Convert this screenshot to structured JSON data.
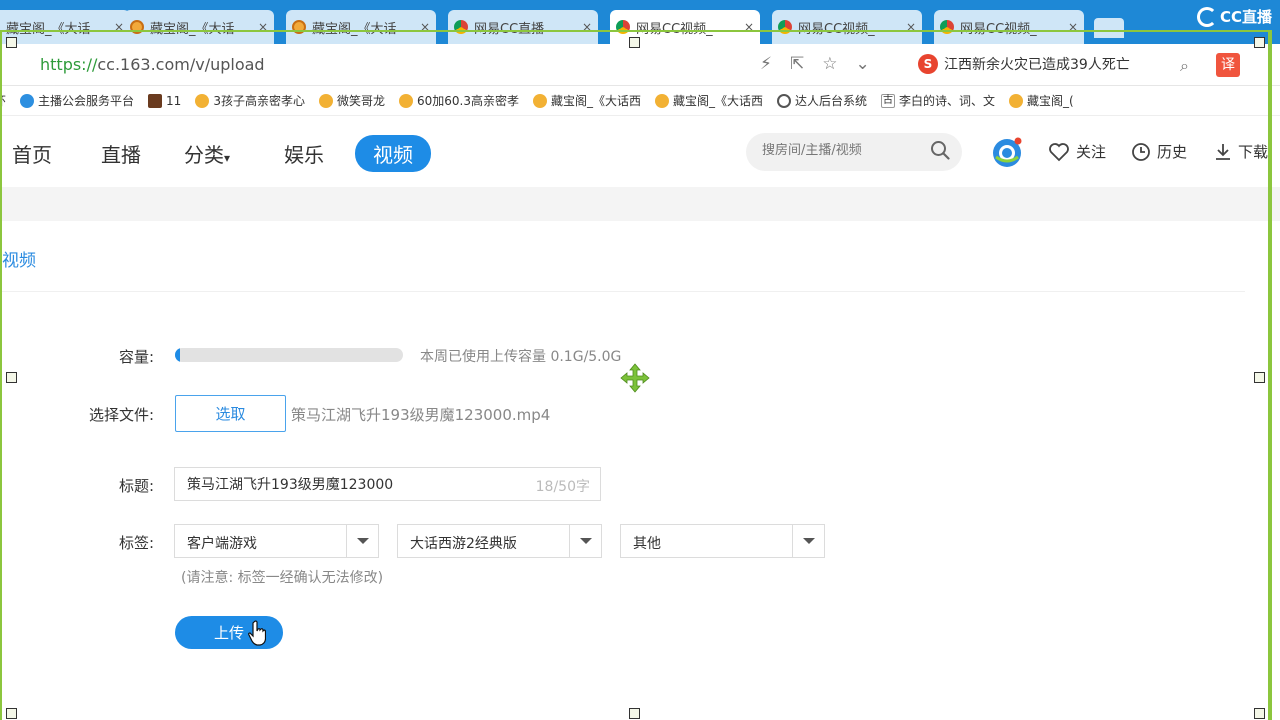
{
  "browser": {
    "tabs": [
      {
        "title": "藏宝阁_《大话",
        "icon": "treasure-icon"
      },
      {
        "title": "藏宝阁_《大话",
        "icon": "treasure-icon"
      },
      {
        "title": "藏宝阁_《大话",
        "icon": "treasure-icon"
      },
      {
        "title": "网易CC直播",
        "icon": "chrome-icon"
      },
      {
        "title": "网易CC视频_",
        "icon": "chrome-icon"
      },
      {
        "title": "网易CC视频_",
        "icon": "chrome-icon"
      },
      {
        "title": "网易CC视频_",
        "icon": "chrome-icon"
      }
    ],
    "close_glyph": "×",
    "brand": "CC直播",
    "url_scheme": "https://",
    "url_rest": "cc.163.com/v/upload",
    "news_headline": "江西新余火灾已造成39人死亡",
    "translate_label": "译",
    "bookmarks": [
      {
        "label": "环",
        "icon": "none"
      },
      {
        "label": "主播公会服务平台",
        "icon": "blue"
      },
      {
        "label": "11",
        "icon": "dark"
      },
      {
        "label": "3孩子高亲密孝心",
        "icon": "treasure"
      },
      {
        "label": "微笑哥龙",
        "icon": "treasure"
      },
      {
        "label": "60加60.3高亲密孝",
        "icon": "treasure"
      },
      {
        "label": "藏宝阁_《大话西",
        "icon": "treasure"
      },
      {
        "label": "藏宝阁_《大话西",
        "icon": "treasure"
      },
      {
        "label": "达人后台系统",
        "icon": "globe"
      },
      {
        "label": "李白的诗、词、文",
        "icon": "gu"
      },
      {
        "label": "藏宝阁_(",
        "icon": "treasure"
      }
    ]
  },
  "nav": {
    "home": "首页",
    "live": "直播",
    "category": "分类",
    "entertainment": "娱乐",
    "video": "视频",
    "search_placeholder": "搜房间/主播/视频",
    "follow": "关注",
    "history": "历史",
    "download": "下载"
  },
  "upload": {
    "section_title": "视频",
    "capacity_label": "容量:",
    "capacity_used_fraction": 0.02,
    "capacity_text": "本周已使用上传容量 0.1G/5.0G",
    "file_label": "选择文件:",
    "pick_button": "选取",
    "file_name": "策马江湖飞升193级男魔123000.mp4",
    "title_label": "标题:",
    "title_value": "策马江湖飞升193级男魔123000",
    "title_count": "18/50字",
    "tags_label": "标签:",
    "tag1": "客户端游戏",
    "tag2": "大话西游2经典版",
    "tag3": "其他",
    "tags_note": "(请注意: 标签一经确认无法修改)",
    "upload_button": "上传"
  },
  "colors": {
    "accent": "#1e8ce6",
    "tabstrip": "#1e88d6",
    "frame": "#8cc63e"
  }
}
